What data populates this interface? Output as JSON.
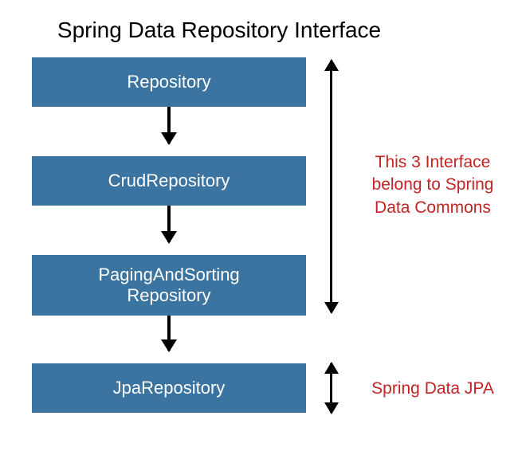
{
  "title": "Spring Data Repository Interface",
  "boxes": {
    "b1": "Repository",
    "b2": "CrudRepository",
    "b3_line1": "PagingAndSorting",
    "b3_line2": "Repository",
    "b4": "JpaRepository"
  },
  "labels": {
    "commons_l1": "This 3 Interface",
    "commons_l2": "belong to Spring",
    "commons_l3": "Data Commons",
    "jpa": "Spring Data JPA"
  },
  "colors": {
    "box_bg": "#3b74a0",
    "label_red": "#c22424"
  }
}
